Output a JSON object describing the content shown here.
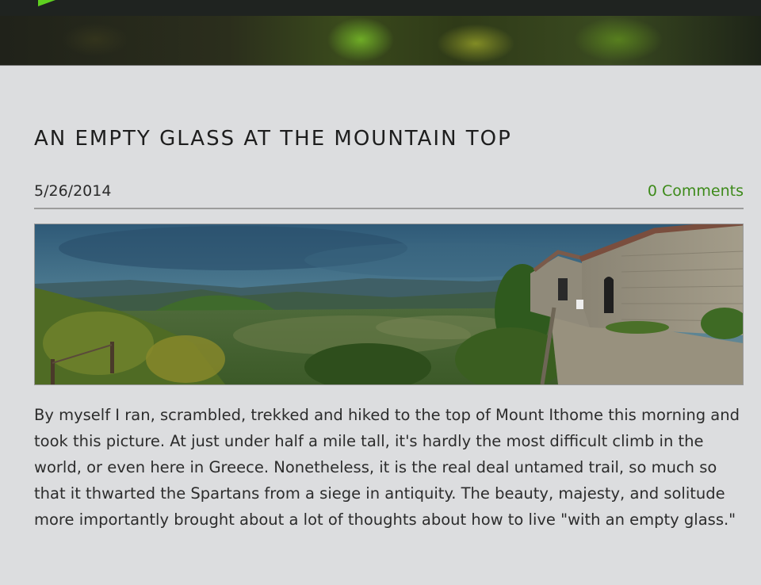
{
  "post": {
    "title": "AN EMPTY GLASS AT THE MOUNTAIN TOP",
    "date": "5/26/2014",
    "comments_label": "0 Comments",
    "body": "By myself I ran, scrambled, trekked and hiked to the top of Mount Ithome this morning and took this picture. At just under half a mile tall, it's hardly the most difficult climb in the world, or even here in Greece. Nonetheless, it is the real deal untamed trail, so much so that it thwarted the Spartans from a siege in antiquity. The beauty, majesty, and solitude more importantly brought about a lot of thoughts about how to live \"with an empty glass.\""
  },
  "colors": {
    "page_background": "#dcdddf",
    "link_green": "#3d8a1a",
    "top_bar": "#1f2320",
    "logo_green": "#5fd020"
  },
  "photo": {
    "subject": "panoramic-mountain-landscape-with-stone-monastery"
  }
}
